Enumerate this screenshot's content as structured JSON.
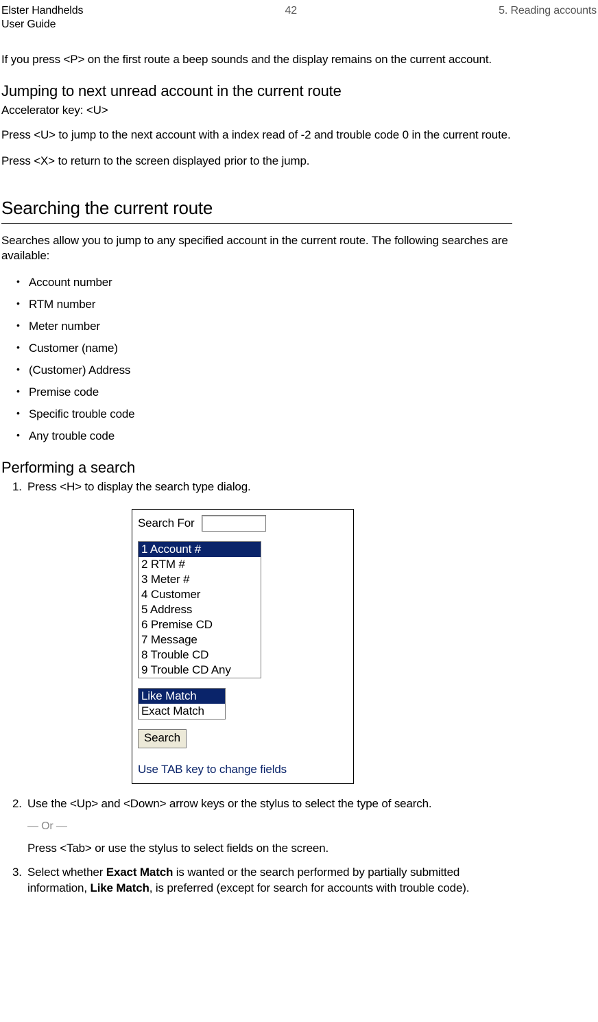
{
  "header": {
    "brand": "Elster Handhelds",
    "guide": "User Guide",
    "page_number": "42",
    "chapter": "5. Reading accounts"
  },
  "intro_para": "If you press <P> on the first route a beep sounds and the display remains on the current account.",
  "jump_section": {
    "heading": "Jumping to next unread account in the current route",
    "accelerator": "Accelerator key: <U>",
    "p1": "Press <U> to jump to the next account with a index read of -2 and trouble code 0 in the current route.",
    "p2": "Press <X> to return to the screen displayed prior to the jump."
  },
  "search_section": {
    "heading": "Searching the current route",
    "intro": "Searches allow you to jump to any specified account in the current route. The following searches are available:",
    "bullets": [
      "Account number",
      "RTM number",
      "Meter number",
      "Customer (name)",
      "(Customer) Address",
      "Premise code",
      "Specific trouble code",
      "Any trouble code"
    ],
    "perform_heading": "Performing a search",
    "step1": "Press <H> to display the search type dialog.",
    "step2": "Use the <Up> and <Down> arrow keys or the stylus to select the type of search.",
    "or_text": "— Or —",
    "step2b": "Press <Tab> or use the stylus to select fields on the screen.",
    "step3_pre": "Select whether ",
    "step3_exact": "Exact Match",
    "step3_mid": " is wanted or the search performed by partially submitted information, ",
    "step3_like": "Like Match",
    "step3_post": ", is preferred (except for search for accounts with trouble code)."
  },
  "dialog": {
    "search_for_label": "Search For",
    "input_value": "",
    "list1": [
      "1 Account #",
      "2 RTM #",
      "3 Meter #",
      "4 Customer",
      "5 Address",
      "6 Premise CD",
      "7 Message",
      "8 Trouble CD",
      "9 Trouble CD Any"
    ],
    "list1_selected_index": 0,
    "list2": [
      "Like Match",
      "Exact Match"
    ],
    "list2_selected_index": 0,
    "button_label": "Search",
    "hint": "Use TAB key to change fields"
  }
}
